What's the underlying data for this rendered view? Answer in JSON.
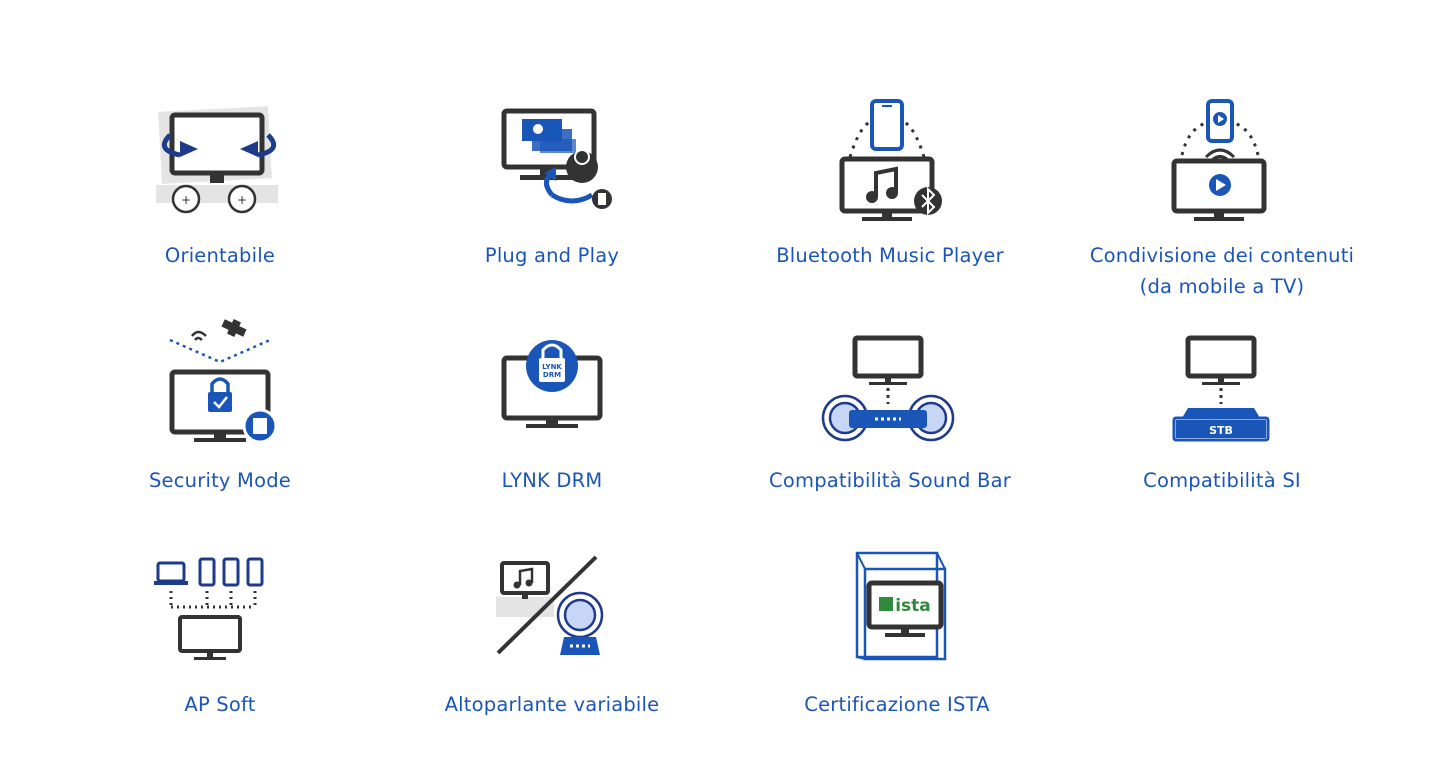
{
  "features": [
    {
      "id": "orientabile",
      "label": "Orientabile",
      "icon": "swivel-monitor-icon"
    },
    {
      "id": "plug-and-play",
      "label": "Plug and Play",
      "icon": "plug-and-play-icon"
    },
    {
      "id": "bluetooth",
      "label": "Bluetooth Music Player",
      "icon": "bluetooth-music-icon"
    },
    {
      "id": "condivisione",
      "label_line1": "Condivisione dei contenuti",
      "label_line2": "(da mobile a TV)",
      "icon": "mobile-to-tv-icon"
    },
    {
      "id": "security",
      "label": "Security Mode",
      "icon": "security-lock-icon"
    },
    {
      "id": "lynk",
      "label": "LYNK DRM",
      "icon": "lynk-drm-icon",
      "badge_line1": "LYNK",
      "badge_line2": "DRM"
    },
    {
      "id": "soundbar",
      "label": "Compatibilità Sound Bar",
      "icon": "soundbar-icon"
    },
    {
      "id": "si",
      "label": "Compatibilità SI",
      "icon": "set-top-box-icon",
      "badge": "STB"
    },
    {
      "id": "ap-soft",
      "label": "AP Soft",
      "icon": "multi-device-icon"
    },
    {
      "id": "altoparlante",
      "label": "Altoparlante variabile",
      "icon": "variable-speaker-icon"
    },
    {
      "id": "ista",
      "label": "Certificazione ISTA",
      "icon": "ista-certification-icon",
      "badge": "ista"
    }
  ],
  "colors": {
    "brand_blue": "#1a56b8",
    "dark_blue": "#1e3a8a",
    "icon_dark": "#333333",
    "ista_green": "#2f8a3c"
  }
}
